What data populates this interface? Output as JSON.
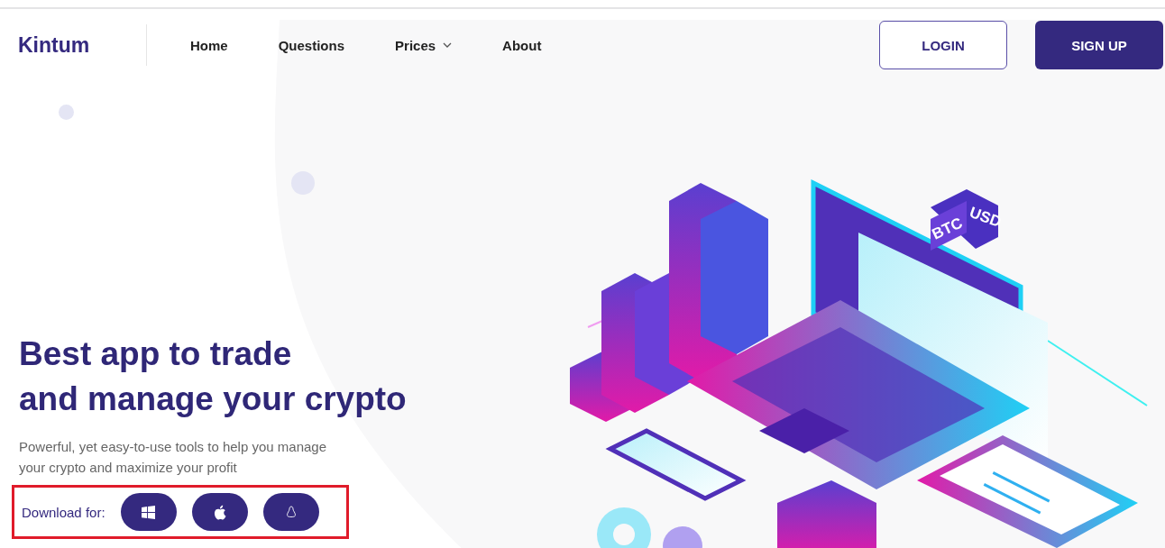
{
  "header": {
    "logo": "Kintum",
    "nav": [
      {
        "label": "Home",
        "dropdown": false
      },
      {
        "label": "Questions",
        "dropdown": false
      },
      {
        "label": "Prices",
        "dropdown": true
      },
      {
        "label": "About",
        "dropdown": false
      }
    ],
    "login": "LOGIN",
    "signup": "SIGN UP"
  },
  "hero": {
    "title_lines": [
      "Best app to trade",
      "and manage your crypto"
    ],
    "subtitle_lines": [
      "Powerful, yet easy-to-use tools to help you manage",
      "your crypto and maximize your profit"
    ],
    "download_label": "Download for:",
    "platforms": [
      {
        "kind": "windows"
      },
      {
        "kind": "apple"
      },
      {
        "kind": "linux"
      }
    ],
    "highlighted": true
  },
  "illustration": {
    "tags": [
      "BTC",
      "USD"
    ]
  }
}
